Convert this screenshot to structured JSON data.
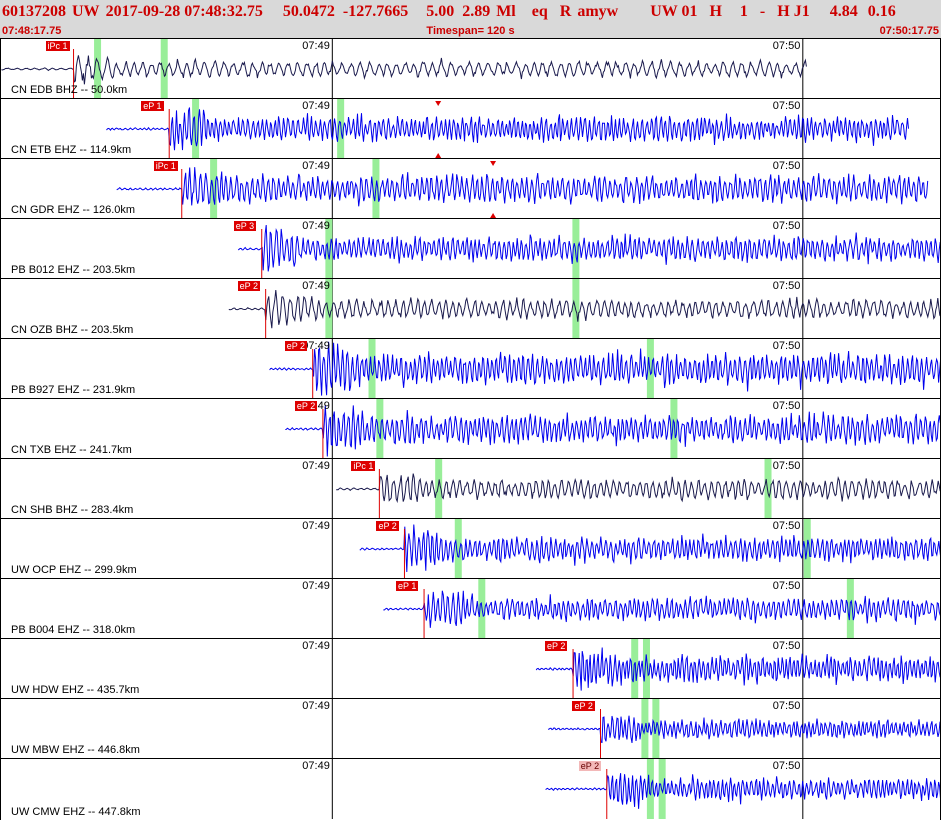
{
  "header": {
    "event_id": "60137208",
    "network": "UW",
    "origin_time": "2017-09-28 07:48:32.75",
    "latitude": "50.0472",
    "longitude": "-127.7665",
    "depth": "5.00",
    "magnitude": "2.89",
    "mag_type": "Ml",
    "event_type": "eq",
    "review": "R",
    "analyst": "amyw",
    "source": "UW 01",
    "gtype": "H",
    "nph": "1",
    "dash": "-",
    "crust": "H J1",
    "rms1": "4.84",
    "rms2": "0.16"
  },
  "subheader": {
    "start_time": "07:48:17.75",
    "timespan": "Timespan= 120 s",
    "end_time": "07:50:17.75"
  },
  "tick_labels": [
    "07:49",
    "07:50"
  ],
  "colors": {
    "trace_blue": "#0000ee",
    "trace_dark": "#1a1a4d",
    "pick_red": "#dd0000",
    "marker_green": "#99ee99",
    "header_bg": "#d9d9d9",
    "header_text": "#cc0000"
  },
  "traces": [
    {
      "label": "CN EDB BHZ -- 50.0km",
      "pick": "iPc 1",
      "pick_t": 27.0,
      "start_t": 17.8,
      "end_t": 120.5,
      "color": "dark",
      "amp": 0.34,
      "freq": 0.55,
      "green": [
        30.0,
        38.5
      ],
      "flags": []
    },
    {
      "label": "CN ETB EHZ -- 114.9km",
      "pick": "eP 1",
      "pick_t": 39.2,
      "start_t": 31.2,
      "end_t": 133.5,
      "color": "blue",
      "amp": 0.55,
      "freq": 1.15,
      "green": [
        42.5,
        61.0
      ],
      "flags": [
        {
          "t": 73.5,
          "pos": "top"
        },
        {
          "t": 73.5,
          "pos": "bottom"
        }
      ]
    },
    {
      "label": "CN GDR EHZ -- 126.0km",
      "pick": "iPc 1",
      "pick_t": 40.8,
      "start_t": 32.5,
      "end_t": 136.0,
      "color": "blue",
      "amp": 0.6,
      "freq": 1.0,
      "green": [
        44.8,
        65.5
      ],
      "flags": [
        {
          "t": 80.5,
          "pos": "top"
        },
        {
          "t": 80.5,
          "pos": "bottom"
        }
      ]
    },
    {
      "label": "PB B012 EHZ -- 203.5km",
      "pick": "eP 3",
      "pick_t": 51.0,
      "start_t": 48.0,
      "end_t": 151.0,
      "color": "blue",
      "amp": 0.55,
      "freq": 1.05,
      "green": [
        59.5,
        91.0
      ],
      "flags": []
    },
    {
      "label": "CN OZB BHZ -- 203.5km",
      "pick": "eP 2",
      "pick_t": 51.5,
      "start_t": 46.8,
      "end_t": 150.5,
      "color": "dark",
      "amp": 0.42,
      "freq": 0.7,
      "green": [
        59.5,
        91.0
      ],
      "flags": []
    },
    {
      "label": "PB B927 EHZ -- 231.9km",
      "pick": "eP 2",
      "pick_t": 57.5,
      "start_t": 52.0,
      "end_t": 154.0,
      "color": "blue",
      "amp": 0.68,
      "freq": 1.1,
      "green": [
        65.0,
        100.5
      ],
      "flags": []
    },
    {
      "label": "CN TXB EHZ -- 241.7km",
      "pick": "eP 2",
      "pick_t": 58.8,
      "start_t": 54.0,
      "end_t": 148.0,
      "color": "blue",
      "amp": 0.62,
      "freq": 1.05,
      "green": [
        66.0,
        103.5
      ],
      "flags": [
        {
          "t": 147.5,
          "pos": "top"
        },
        {
          "t": 147.5,
          "pos": "bottom"
        }
      ]
    },
    {
      "label": "CN SHB BHZ -- 283.4km",
      "pick": "iPc 1",
      "pick_t": 66.0,
      "start_t": 60.5,
      "end_t": 148.5,
      "color": "dark",
      "amp": 0.44,
      "freq": 0.75,
      "green": [
        73.5,
        115.5
      ],
      "flags": []
    },
    {
      "label": "UW OCP EHZ -- 299.9km",
      "pick": "eP 2",
      "pick_t": 69.2,
      "start_t": 63.5,
      "end_t": 154.0,
      "color": "blue",
      "amp": 0.55,
      "freq": 1.1,
      "green": [
        76.0,
        120.5
      ],
      "flags": []
    },
    {
      "label": "PB B004 EHZ -- 318.0km",
      "pick": "eP 1",
      "pick_t": 71.7,
      "start_t": 66.5,
      "end_t": 152.0,
      "color": "blue",
      "amp": 0.5,
      "freq": 1.05,
      "green": [
        79.0,
        126.0
      ],
      "flags": []
    },
    {
      "label": "UW HDW EHZ -- 435.7km",
      "pick": "eP 2",
      "pick_t": 90.7,
      "start_t": 86.0,
      "end_t": 154.0,
      "color": "blue",
      "amp": 0.6,
      "freq": 1.2,
      "green": [
        98.5,
        100.0
      ],
      "flags": []
    },
    {
      "label": "UW MBW EHZ -- 446.8km",
      "pick": "eP 2",
      "pick_t": 94.2,
      "start_t": 87.5,
      "end_t": 154.0,
      "color": "blue",
      "amp": 0.42,
      "freq": 1.2,
      "green": [
        99.8,
        101.2
      ],
      "flags": []
    },
    {
      "label": "UW CMW EHZ -- 447.8km",
      "pick": "eP 2",
      "pick_t": 95.0,
      "start_t": 87.2,
      "end_t": 154.0,
      "color": "blue",
      "amp": 0.48,
      "freq": 1.2,
      "green": [
        100.5,
        102.0
      ],
      "flags": [],
      "light_pick": true
    }
  ]
}
